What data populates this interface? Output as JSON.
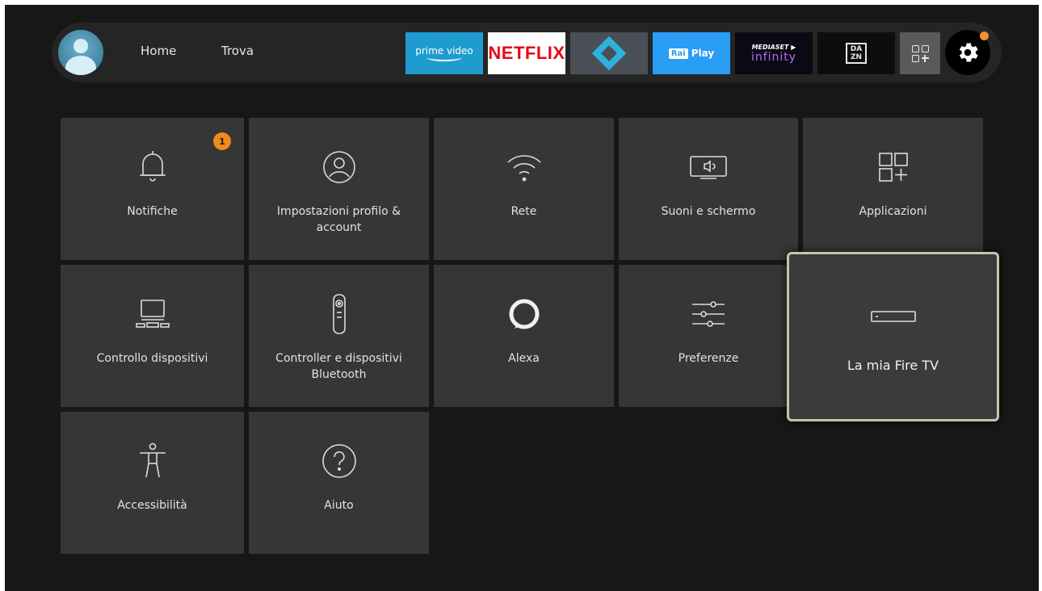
{
  "nav": {
    "home": "Home",
    "find": "Trova",
    "apps": {
      "prime": "prime video",
      "netflix": "NETFLIX",
      "raiplay_rai": "Rai",
      "raiplay_play": "Play",
      "mediaset_top": "MEDIASET ▶",
      "mediaset_bottom": "infinity",
      "dazn_top": "DA",
      "dazn_bottom": "ZN"
    }
  },
  "tiles": {
    "notifiche": {
      "label": "Notifiche",
      "badge": "1"
    },
    "profilo": {
      "label": "Impostazioni profilo & account"
    },
    "rete": {
      "label": "Rete"
    },
    "suoni": {
      "label": "Suoni e schermo"
    },
    "applicazioni": {
      "label": "Applicazioni"
    },
    "controllo": {
      "label": "Controllo dispositivi"
    },
    "controller": {
      "label": "Controller e dispositivi Bluetooth"
    },
    "alexa": {
      "label": "Alexa"
    },
    "preferenze": {
      "label": "Preferenze"
    },
    "firetv": {
      "label": "La mia Fire TV"
    },
    "accessibilita": {
      "label": "Accessibilità"
    },
    "aiuto": {
      "label": "Aiuto"
    }
  },
  "colors": {
    "background": "#171717",
    "tile": "#363636",
    "accent_badge": "#f08a1c",
    "focus_border": "#c9c4a8"
  }
}
